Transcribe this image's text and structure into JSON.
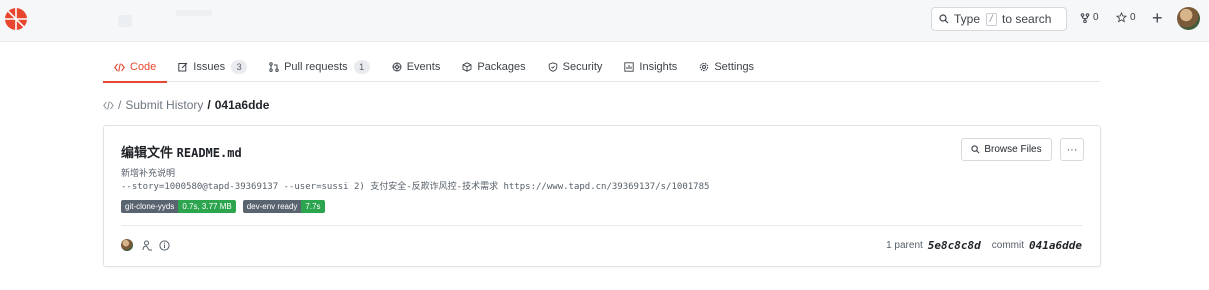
{
  "header": {
    "search_label": "Type",
    "search_key": "/",
    "search_suffix": "to search",
    "forks_count": "0",
    "stars_count": "0",
    "plus": "+"
  },
  "tabs": [
    {
      "label": "Code",
      "icon": "code-icon"
    },
    {
      "label": "Issues",
      "count": "3",
      "icon": "issue-icon"
    },
    {
      "label": "Pull requests",
      "count": "1",
      "icon": "pull-request-icon"
    },
    {
      "label": "Events",
      "icon": "events-icon"
    },
    {
      "label": "Packages",
      "icon": "package-icon"
    },
    {
      "label": "Security",
      "icon": "shield-icon"
    },
    {
      "label": "Insights",
      "icon": "insights-icon"
    },
    {
      "label": "Settings",
      "icon": "gear-icon"
    }
  ],
  "breadcrumb": {
    "sep1": "/",
    "history": "Submit History",
    "sep2": "/",
    "current": "041a6dde"
  },
  "commit": {
    "title_prefix": "编辑文件",
    "title_file": "README.md",
    "body_line1": "新增补充说明",
    "body_line2": "--story=1000580@tapd-39369137 --user=sussi 2) 支付安全-反欺诈风控-技术需求 https://www.tapd.cn/39369137/s/1001785",
    "badges": [
      {
        "key": "git-clone-yyds",
        "value": "0.7s, 3.77 MB"
      },
      {
        "key": "dev-env ready",
        "value": "7.7s"
      }
    ],
    "browse_label": "Browse Files",
    "more_label": "···",
    "parent_label": "1 parent",
    "parent_sha": "5e8c8c8d",
    "commit_label": "commit",
    "commit_sha": "041a6dde"
  },
  "colors": {
    "accent": "#e8472f",
    "badge_key_bg": "#5a6470",
    "badge_value_bg": "#2da44e"
  }
}
